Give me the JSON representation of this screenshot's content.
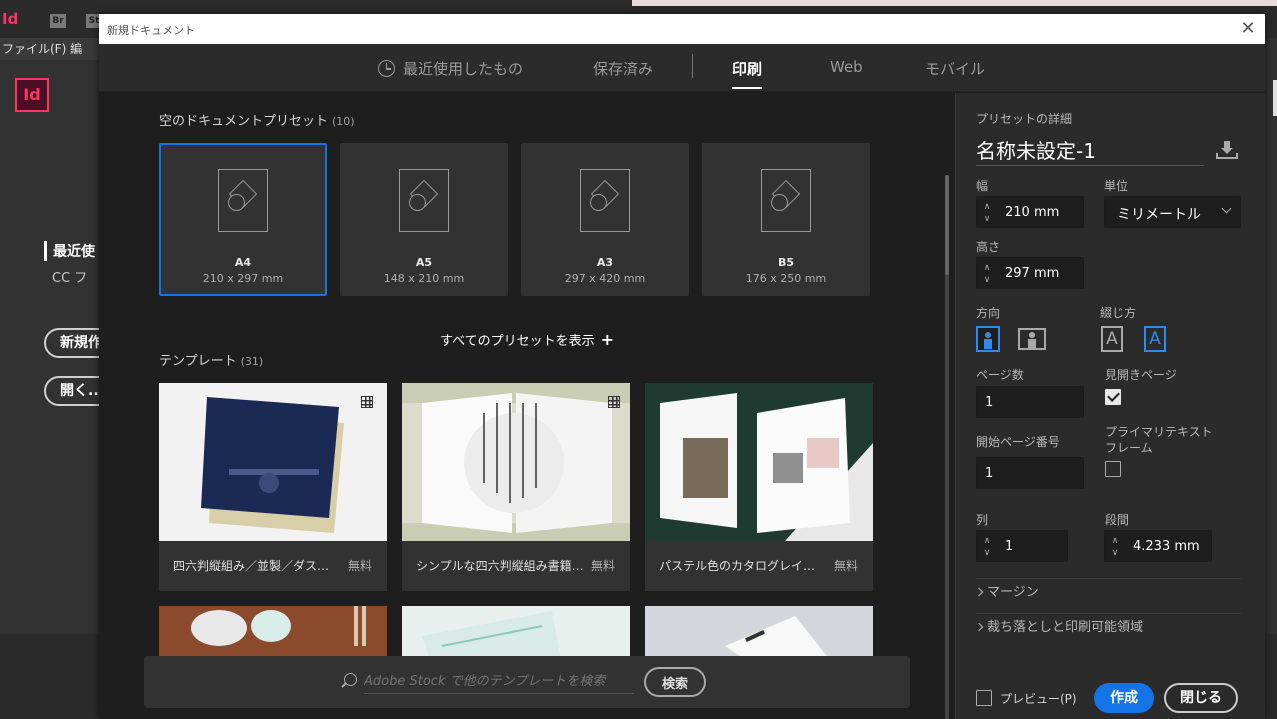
{
  "background_app": {
    "id_small": "Id",
    "chip_br": "Br",
    "chip_st": "St",
    "menu": "ファイル(F)  編",
    "id_logo": "Id",
    "recent_label": "最近使",
    "cc_label": "CC フ",
    "new_button": "新規作",
    "open_button": "開く..."
  },
  "dialog": {
    "title": "新規ドキュメント",
    "close_glyph": "✕",
    "tabs": [
      {
        "label": "最近使用したもの"
      },
      {
        "label": "保存済み"
      },
      {
        "label": "印刷"
      },
      {
        "label": "Web"
      },
      {
        "label": "モバイル"
      }
    ],
    "active_tab": "印刷"
  },
  "presets": {
    "title": "空のドキュメントプリセット",
    "count": "(10)",
    "items": [
      {
        "name": "A4",
        "size": "210 x 297 mm"
      },
      {
        "name": "A5",
        "size": "148 x 210 mm"
      },
      {
        "name": "A3",
        "size": "297 x 420 mm"
      },
      {
        "name": "B5",
        "size": "176 x 250 mm"
      }
    ],
    "show_all": "すべてのプリセットを表示"
  },
  "templates": {
    "title": "テンプレート",
    "count": "(31)",
    "items": [
      {
        "caption": "四六判縦組み／並製／ダストカバー",
        "price": "無料"
      },
      {
        "caption": "シンプルな四六判縦組み書籍テンプレート",
        "price": "無料"
      },
      {
        "caption": "パステル色のカタログレイアウト",
        "price": "無料"
      }
    ]
  },
  "search": {
    "placeholder": "Adobe Stock で他のテンプレートを検索",
    "button": "検索"
  },
  "details": {
    "header": "プリセットの詳細",
    "name": "名称未設定-1",
    "width_label": "幅",
    "width_value": "210 mm",
    "unit_label": "単位",
    "unit_value": "ミリメートル",
    "height_label": "高さ",
    "height_value": "297 mm",
    "orientation_label": "方向",
    "binding_label": "綴じ方",
    "pages_label": "ページ数",
    "pages_value": "1",
    "facing_label": "見開きページ",
    "facing_checked": true,
    "start_page_label": "開始ページ番号",
    "start_page_value": "1",
    "primary_text_label_1": "プライマリテキスト",
    "primary_text_label_2": "フレーム",
    "columns_label": "列",
    "columns_value": "1",
    "gutter_label": "段間",
    "gutter_value": "4.233 mm",
    "margins": "マージン",
    "bleed": "裁ち落としと印刷可能領域",
    "preview_label": "プレビュー(P)",
    "create_button": "作成",
    "close_button": "閉じる"
  },
  "colors": {
    "accent": "#1473e6",
    "brand_id": "#ff3366"
  }
}
